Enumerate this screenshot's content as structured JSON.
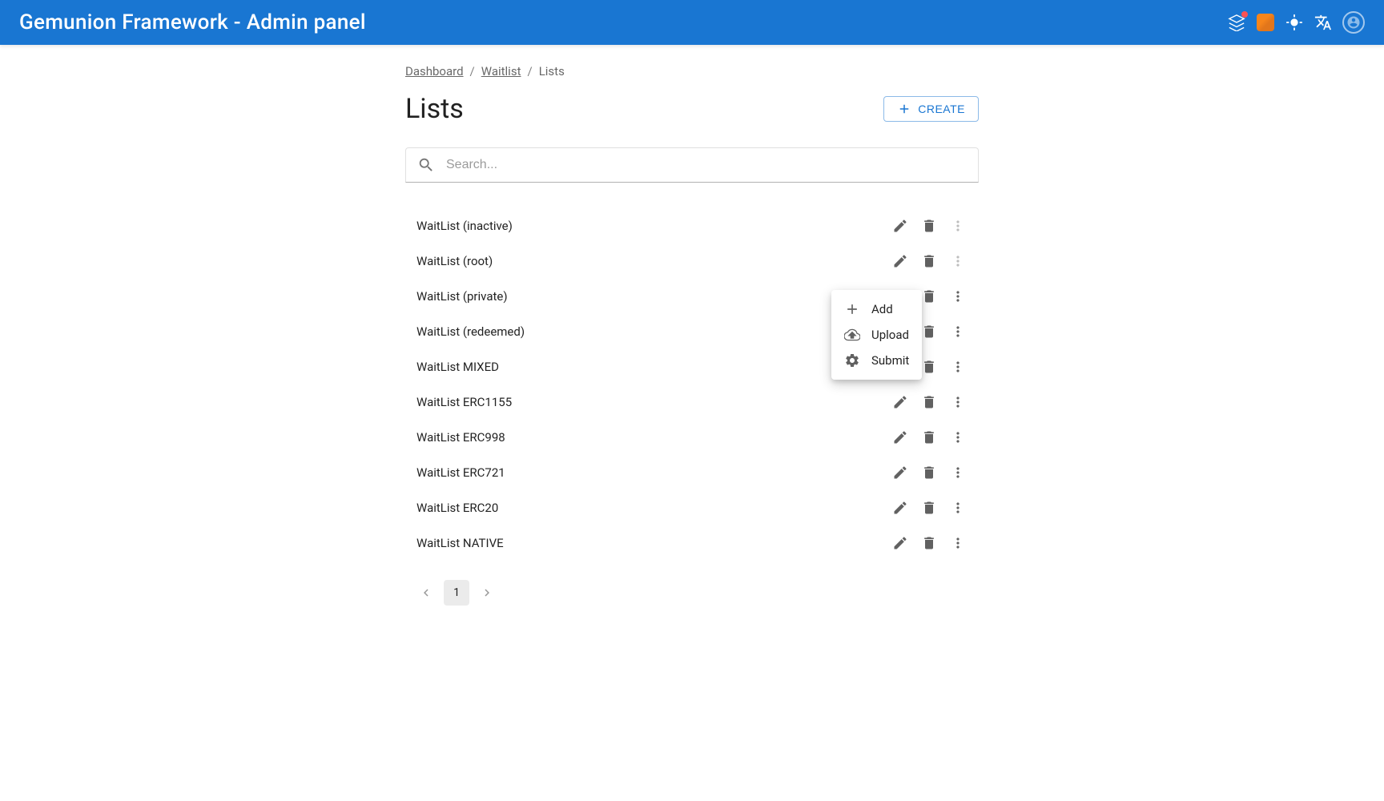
{
  "header": {
    "title": "Gemunion Framework - Admin panel"
  },
  "breadcrumbs": {
    "items": [
      {
        "label": "Dashboard",
        "link": true
      },
      {
        "label": "Waitlist",
        "link": true
      },
      {
        "label": "Lists",
        "link": false
      }
    ]
  },
  "page": {
    "title": "Lists",
    "create_label": "CREATE"
  },
  "search": {
    "placeholder": "Search..."
  },
  "list": {
    "items": [
      {
        "label": "WaitList (inactive)",
        "more_enabled": false
      },
      {
        "label": "WaitList (root)",
        "more_enabled": false
      },
      {
        "label": "WaitList (private)",
        "more_enabled": true
      },
      {
        "label": "WaitList (redeemed)",
        "more_enabled": true
      },
      {
        "label": "WaitList MIXED",
        "more_enabled": true
      },
      {
        "label": "WaitList ERC1155",
        "more_enabled": true
      },
      {
        "label": "WaitList ERC998",
        "more_enabled": true
      },
      {
        "label": "WaitList ERC721",
        "more_enabled": true
      },
      {
        "label": "WaitList ERC20",
        "more_enabled": true
      },
      {
        "label": "WaitList NATIVE",
        "more_enabled": true
      }
    ]
  },
  "popover": {
    "items": [
      {
        "label": "Add",
        "icon": "plus"
      },
      {
        "label": "Upload",
        "icon": "cloud-upload"
      },
      {
        "label": "Submit",
        "icon": "gear"
      }
    ]
  },
  "pagination": {
    "current": "1"
  }
}
